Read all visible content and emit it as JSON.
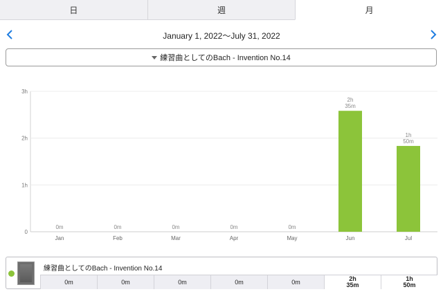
{
  "tabs": [
    {
      "label": "日",
      "active": false
    },
    {
      "label": "週",
      "active": false
    },
    {
      "label": "月",
      "active": true
    }
  ],
  "date_range": "January 1, 2022〜July 31, 2022",
  "selector": {
    "label": "練習曲としてのBach - Invention No.14"
  },
  "colors": {
    "bar": "#8cc43a",
    "accent": "#1f7de0"
  },
  "chart_data": {
    "type": "bar",
    "categories": [
      "Jan",
      "Feb",
      "Mar",
      "Apr",
      "May",
      "Jun",
      "Jul"
    ],
    "values": [
      0,
      0,
      0,
      0,
      0,
      155,
      110
    ],
    "value_labels": [
      [
        "0m"
      ],
      [
        "0m"
      ],
      [
        "0m"
      ],
      [
        "0m"
      ],
      [
        "0m"
      ],
      [
        "2h",
        "35m"
      ],
      [
        "1h",
        "50m"
      ]
    ],
    "y_unit": "minutes",
    "ylim": [
      0,
      180
    ],
    "yticks": [
      {
        "value": 0,
        "label": "0"
      },
      {
        "value": 60,
        "label": "1h"
      },
      {
        "value": 120,
        "label": "2h"
      },
      {
        "value": 180,
        "label": "3h"
      }
    ],
    "grid": true
  },
  "legend": {
    "title": "練習曲としてのBach - Invention No.14",
    "cells": [
      "0m",
      "0m",
      "0m",
      "0m",
      "0m",
      "2h\n35m",
      "1h\n50m"
    ]
  }
}
